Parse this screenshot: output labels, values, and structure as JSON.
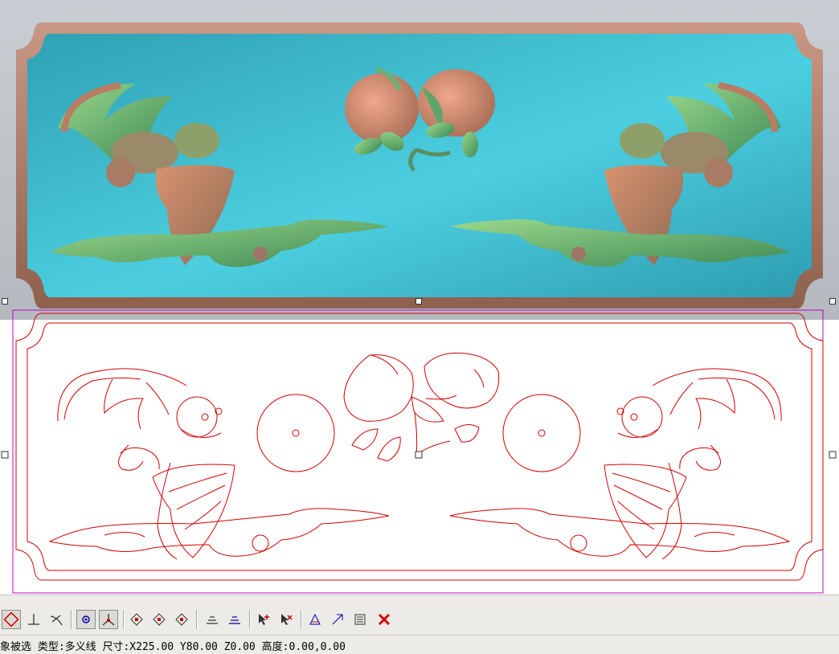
{
  "status_bar": {
    "text": "象被选 类型:多义线 尺寸:X225.00 Y80.00 Z0.00 高度:0.00,0.00"
  },
  "colors": {
    "panel_blue": "#3fb6c8",
    "frame_brown": "#b07f6a",
    "relief_green": "#6fb070",
    "relief_peach": "#d68a6a",
    "vector_line": "#d40000",
    "selection_box": "#c000c0"
  },
  "toolbar": {
    "buttons": [
      {
        "name": "snap-node-button",
        "icon": "node-snap-icon",
        "pressed": true
      },
      {
        "name": "snap-perpendicular-button",
        "icon": "perpendicular-icon",
        "pressed": false
      },
      {
        "name": "snap-tangent-button",
        "icon": "tangent-icon",
        "pressed": false
      },
      {
        "name": "snap-center-button",
        "icon": "center-snap-icon",
        "pressed": true
      },
      {
        "name": "snap-intersection-button",
        "icon": "intersection-icon",
        "pressed": true
      },
      {
        "name": "node-edit-button-1",
        "icon": "diamond-node-icon",
        "pressed": false
      },
      {
        "name": "node-edit-button-2",
        "icon": "diamond-node-icon",
        "pressed": false
      },
      {
        "name": "node-edit-button-3",
        "icon": "diamond-node-icon",
        "pressed": false
      },
      {
        "name": "layer-button-1",
        "icon": "layers-icon",
        "pressed": false
      },
      {
        "name": "layer-button-2",
        "icon": "layers-icon",
        "pressed": false
      },
      {
        "name": "select-add-button",
        "icon": "cursor-plus-icon",
        "pressed": false
      },
      {
        "name": "select-remove-button",
        "icon": "cursor-minus-icon",
        "pressed": false
      },
      {
        "name": "transform-button-1",
        "icon": "transform-icon",
        "pressed": false
      },
      {
        "name": "transform-button-2",
        "icon": "transform-icon",
        "pressed": false
      },
      {
        "name": "properties-button",
        "icon": "list-icon",
        "pressed": false
      },
      {
        "name": "delete-button",
        "icon": "close-icon",
        "pressed": false
      }
    ]
  }
}
